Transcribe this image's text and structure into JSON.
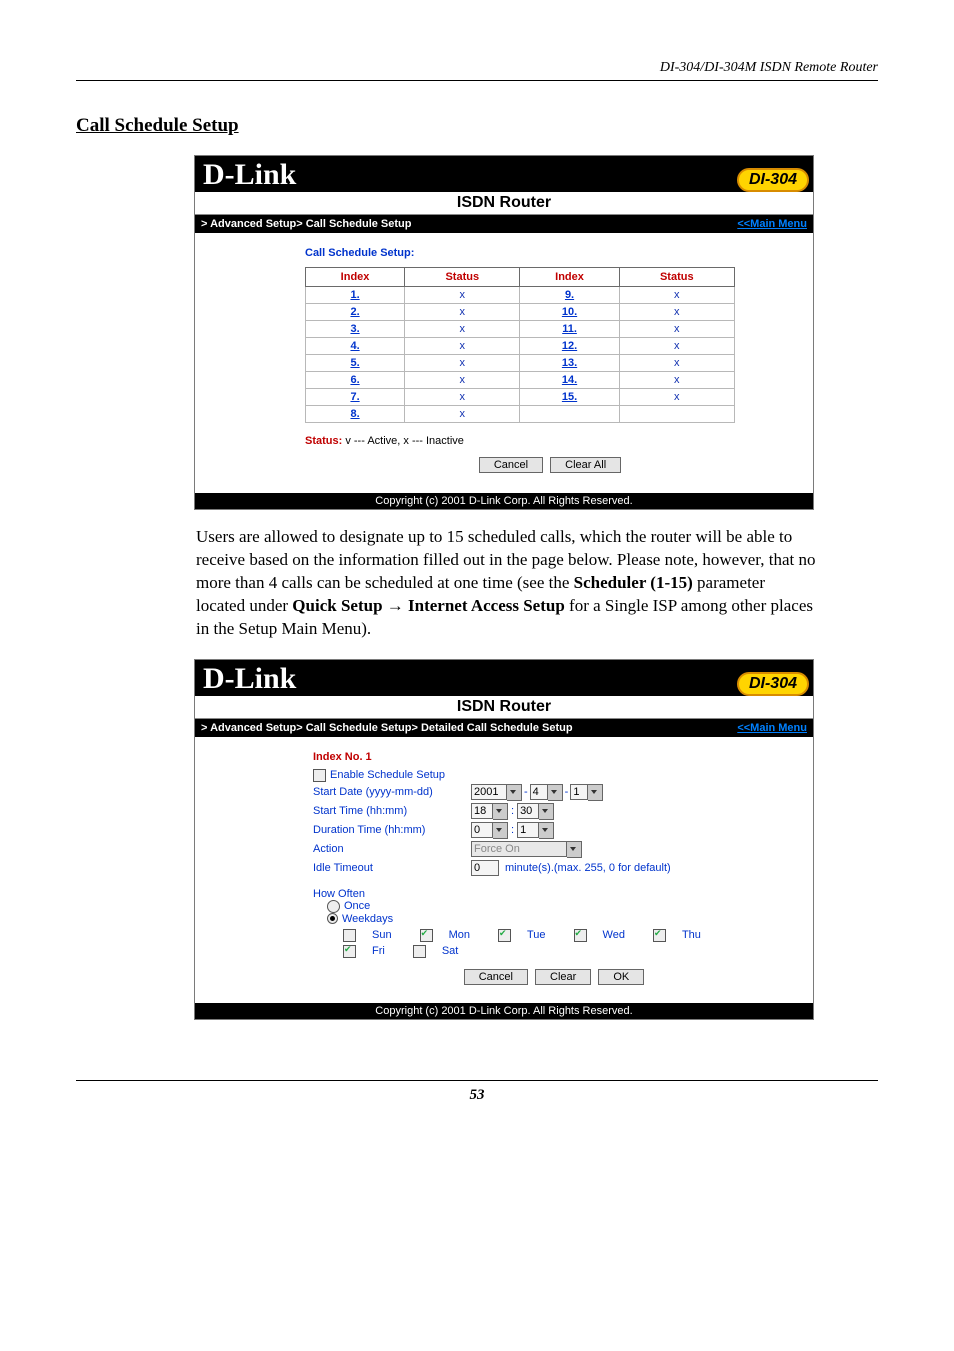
{
  "running_header": "DI-304/DI-304M ISDN Remote Router",
  "section_heading": "Call Schedule Setup",
  "shot1": {
    "brand": "D-Link",
    "title": "ISDN Router",
    "model": "DI-304",
    "breadcrumb": "> Advanced Setup> Call Schedule Setup",
    "mainmenu": "<<Main Menu",
    "subhead": "Call Schedule Setup:",
    "headers": [
      "Index",
      "Status",
      "Index",
      "Status"
    ],
    "rows": [
      {
        "l_idx": "1.",
        "l_st": "x",
        "r_idx": "9.",
        "r_st": "x"
      },
      {
        "l_idx": "2.",
        "l_st": "x",
        "r_idx": "10.",
        "r_st": "x"
      },
      {
        "l_idx": "3.",
        "l_st": "x",
        "r_idx": "11.",
        "r_st": "x"
      },
      {
        "l_idx": "4.",
        "l_st": "x",
        "r_idx": "12.",
        "r_st": "x"
      },
      {
        "l_idx": "5.",
        "l_st": "x",
        "r_idx": "13.",
        "r_st": "x"
      },
      {
        "l_idx": "6.",
        "l_st": "x",
        "r_idx": "14.",
        "r_st": "x"
      },
      {
        "l_idx": "7.",
        "l_st": "x",
        "r_idx": "15.",
        "r_st": "x"
      },
      {
        "l_idx": "8.",
        "l_st": "x",
        "r_idx": "",
        "r_st": ""
      }
    ],
    "legend_label": "Status:",
    "legend_text": " v --- Active, x --- Inactive",
    "btn_cancel": "Cancel",
    "btn_clear": "Clear All",
    "copyright": "Copyright (c) 2001 D-Link Corp. All Rights Reserved."
  },
  "paragraph": {
    "p1a": "Users are allowed to designate up to 15 scheduled calls, which the router will be able to receive based on the information filled out in the page below. Please note, however, that no more than 4 calls can be scheduled at one time (see the ",
    "b1": "Scheduler (1-15)",
    "p1b": " parameter located under ",
    "b2": "Quick Setup",
    "arrow": " → ",
    "b3": "Internet Access Setup",
    "p1c": " for a Single ISP among other places in the Setup Main Menu)."
  },
  "shot2": {
    "brand": "D-Link",
    "title": "ISDN Router",
    "model": "DI-304",
    "breadcrumb": "> Advanced Setup> Call Schedule Setup> Detailed Call Schedule Setup",
    "mainmenu": "<<Main Menu",
    "idxno": "Index No. 1",
    "enable_label": "Enable Schedule Setup",
    "start_date_label": "Start Date (yyyy-mm-dd)",
    "start_date": {
      "y": "2001",
      "m": "4",
      "d": "1"
    },
    "start_time_label": "Start Time (hh:mm)",
    "start_time": {
      "h": "18",
      "m": "30"
    },
    "duration_label": "Duration Time (hh:mm)",
    "duration": {
      "h": "0",
      "m": "1"
    },
    "action_label": "Action",
    "action_value": "Force On",
    "idle_label": "Idle Timeout",
    "idle_value": "0",
    "idle_note": "minute(s).(max. 255, 0 for default)",
    "how_often": "How Often",
    "once": "Once",
    "weekdays": "Weekdays",
    "days": [
      {
        "name": "Sun",
        "checked": false
      },
      {
        "name": "Mon",
        "checked": true
      },
      {
        "name": "Tue",
        "checked": true
      },
      {
        "name": "Wed",
        "checked": true
      },
      {
        "name": "Thu",
        "checked": true
      },
      {
        "name": "Fri",
        "checked": true
      },
      {
        "name": "Sat",
        "checked": false
      }
    ],
    "btn_cancel": "Cancel",
    "btn_clear": "Clear",
    "btn_ok": "OK",
    "copyright": "Copyright (c) 2001 D-Link Corp. All Rights Reserved."
  },
  "page_number": "53"
}
